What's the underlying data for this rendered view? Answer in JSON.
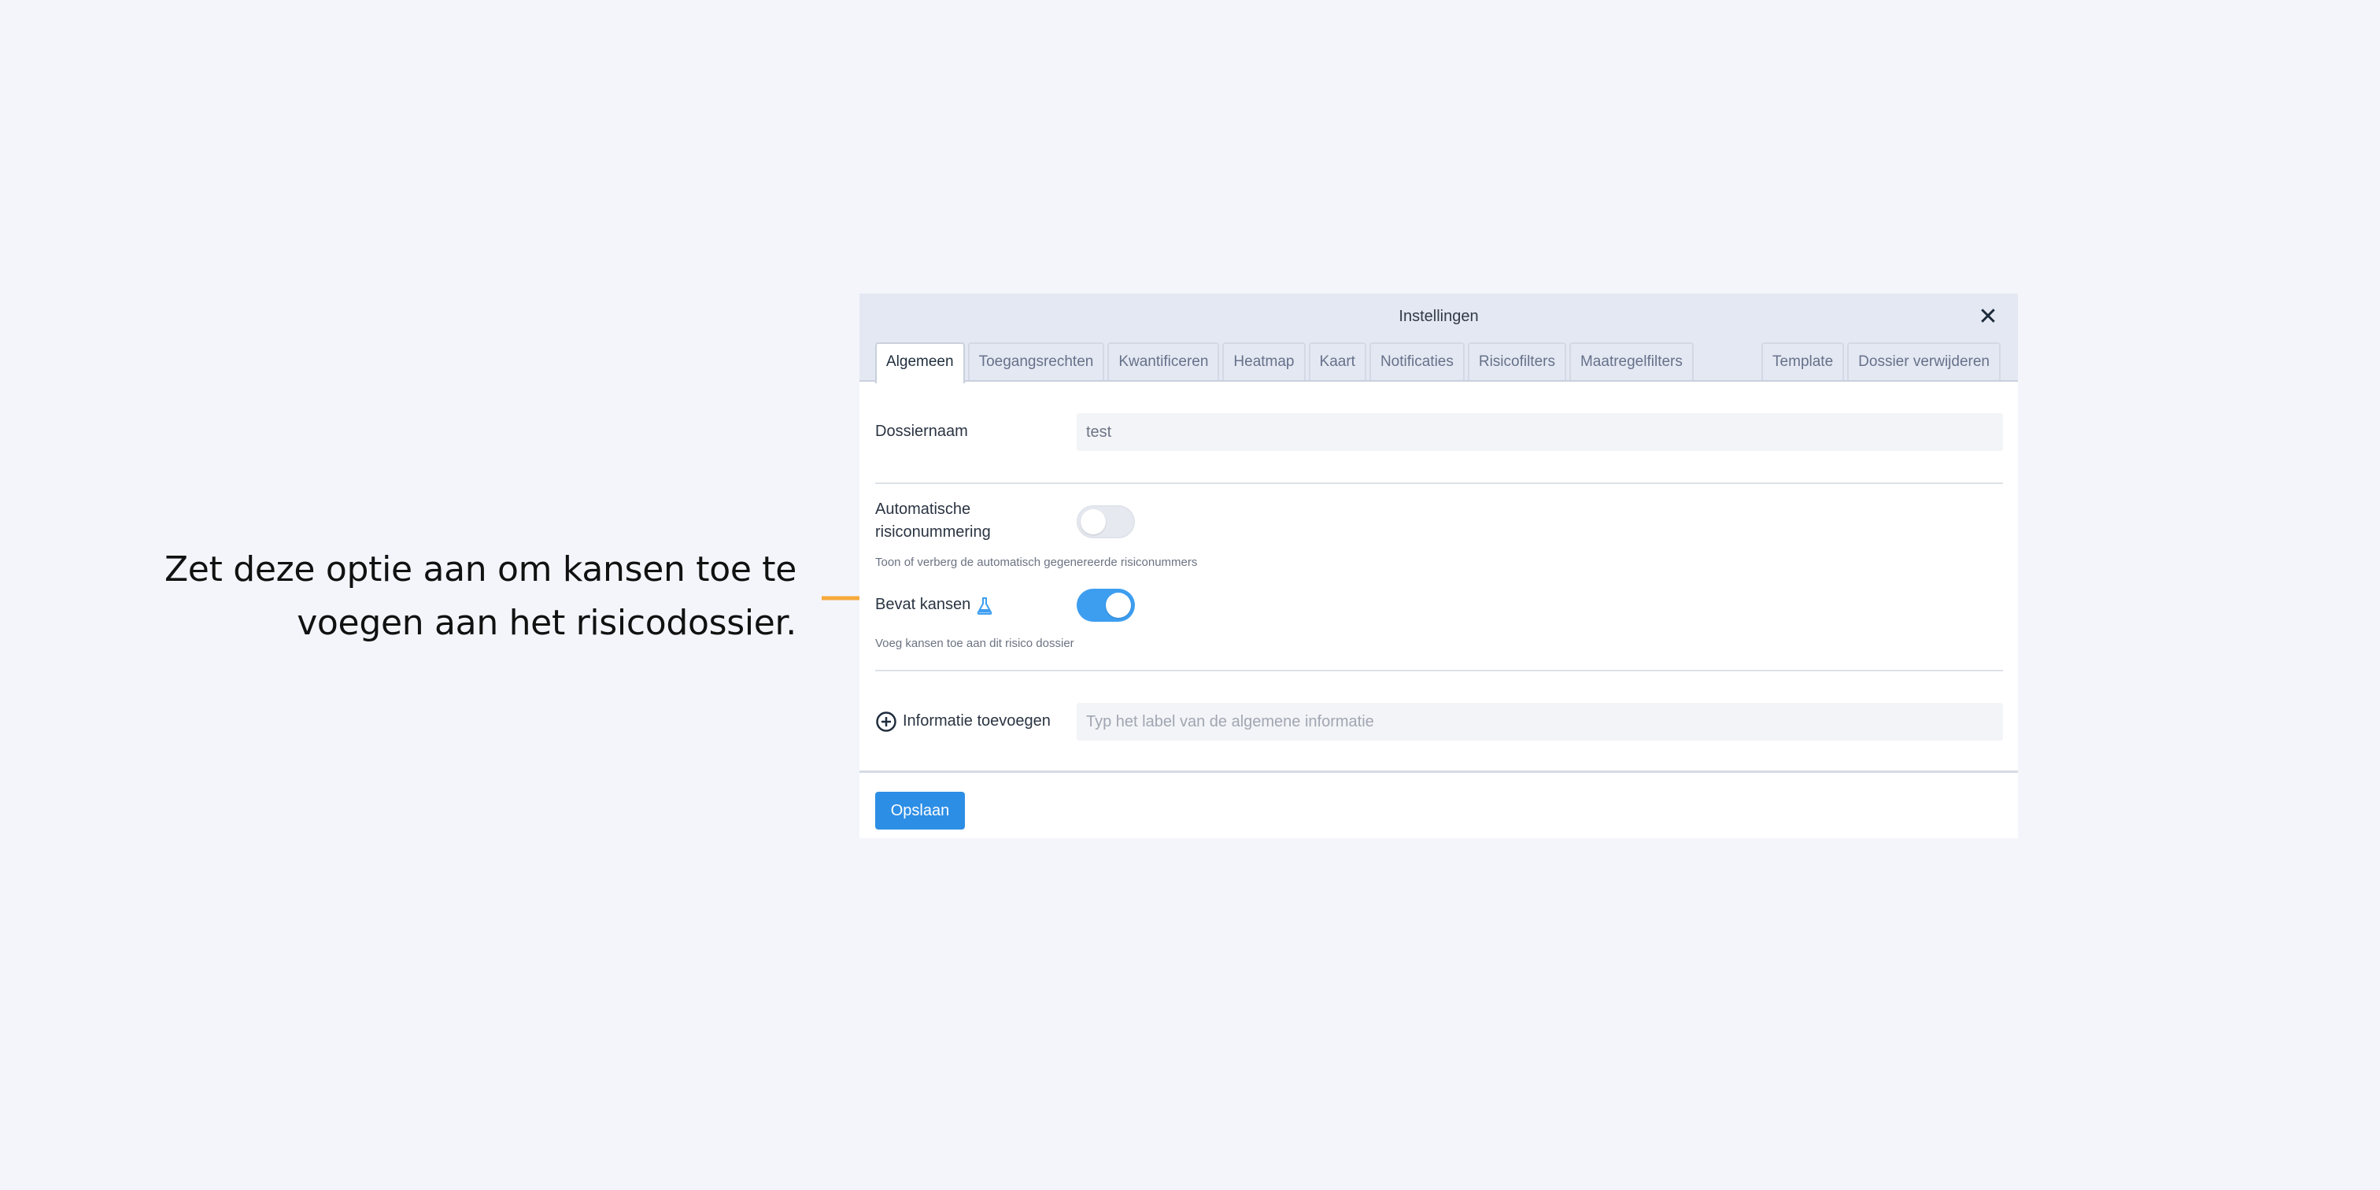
{
  "callout": {
    "line1": "Zet deze optie aan om kansen toe te",
    "line2": "voegen aan het risicodossier.",
    "arrow_color": "#f6a93b"
  },
  "modal": {
    "title": "Instellingen",
    "close_icon": "close-icon",
    "tabs_left": [
      "Algemeen",
      "Toegangsrechten",
      "Kwantificeren",
      "Heatmap",
      "Kaart",
      "Notificaties",
      "Risicofilters",
      "Maatregelfilters"
    ],
    "tabs_right": [
      "Template",
      "Dossier verwijderen"
    ],
    "active_tab": "Algemeen"
  },
  "form": {
    "dossiernaam": {
      "label": "Dossiernaam",
      "value": "test"
    },
    "auto_numbering": {
      "label_line1": "Automatische",
      "label_line2": "risiconummering",
      "help": "Toon of verberg de automatisch gegenereerde risiconummers",
      "enabled": false
    },
    "bevat_kansen": {
      "label": "Bevat kansen",
      "help": "Voeg kansen toe aan dit risico dossier",
      "enabled": true,
      "badge_icon": "beaker-icon"
    },
    "info": {
      "label": "Informatie toevoegen",
      "placeholder": "Typ het label van de algemene informatie",
      "icon": "plus-circle-icon"
    }
  },
  "footer": {
    "save_label": "Opslaan"
  },
  "colors": {
    "accent": "#2d8ee5",
    "toggle_on": "#3d9ef0",
    "background": "#f4f5fb"
  }
}
